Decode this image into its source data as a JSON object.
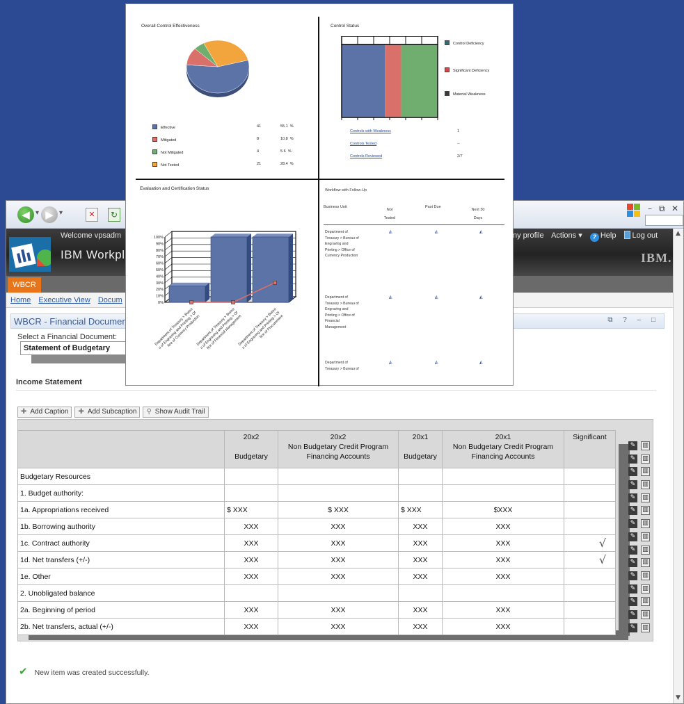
{
  "browser": {
    "app": {
      "welcome": "Welcome vpsadm",
      "title": "IBM Workpla",
      "links": [
        "ny profile",
        "Actions ▾",
        "Help",
        "Log out"
      ],
      "brand": "IBM."
    },
    "tab": "WBCR",
    "nav_links": [
      "Home",
      "Executive View",
      "Docum"
    ],
    "portlet_title": "WBCR - Financial Documen",
    "select_label": "Select a Financial Document:",
    "select_value": "Statement of Budgetary",
    "section_title": "Income Statement",
    "buttons": {
      "add_caption": "Add Caption",
      "add_subcaption": "Add Subcaption",
      "show_audit_trail": "Show Audit Trail"
    },
    "table": {
      "headers": [
        {
          "line1": "",
          "line2": ""
        },
        {
          "line1": "20x2",
          "line2": "",
          "line3": "Budgetary"
        },
        {
          "line1": "20x2",
          "line2": "Non Budgetary Credit Program",
          "line3": "Financing Accounts"
        },
        {
          "line1": "20x1",
          "line2": "",
          "line3": "Budgetary"
        },
        {
          "line1": "20x1",
          "line2": "Non Budgetary Credit Program",
          "line3": "Financing Accounts"
        },
        {
          "line1": "Significant",
          "line2": "",
          "line3": ""
        }
      ],
      "rows": [
        {
          "label": "Budgetary Resources",
          "c1": "",
          "c2": "",
          "c3": "",
          "c4": "",
          "sig": ""
        },
        {
          "label": "1.   Budget authority:",
          "c1": "",
          "c2": "",
          "c3": "",
          "c4": "",
          "sig": ""
        },
        {
          "label": "1a.  Appropriations received",
          "c1": "$     XXX",
          "c2": "$ XXX",
          "c3": "$     XXX",
          "c4": "$XXX",
          "sig": ""
        },
        {
          "label": "1b.  Borrowing authority",
          "c1": "XXX",
          "c2": "XXX",
          "c3": "XXX",
          "c4": "XXX",
          "sig": ""
        },
        {
          "label": "1c.  Contract authority",
          "c1": "XXX",
          "c2": "XXX",
          "c3": "XXX",
          "c4": "XXX",
          "sig": "√"
        },
        {
          "label": "1d.  Net transfers (+/-)",
          "c1": "XXX",
          "c2": "XXX",
          "c3": "XXX",
          "c4": "XXX",
          "sig": "√"
        },
        {
          "label": "1e.  Other",
          "c1": "XXX",
          "c2": "XXX",
          "c3": "XXX",
          "c4": "XXX",
          "sig": ""
        },
        {
          "label": "2.    Unobligated balance",
          "c1": "",
          "c2": "",
          "c3": "",
          "c4": "",
          "sig": ""
        },
        {
          "label": "2a.  Beginning of period",
          "c1": "XXX",
          "c2": "XXX",
          "c3": "XXX",
          "c4": "XXX",
          "sig": ""
        },
        {
          "label": "2b.  Net transfers, actual (+/-)",
          "c1": "XXX",
          "c2": "XXX",
          "c3": "XXX",
          "c4": "XXX",
          "sig": ""
        }
      ]
    },
    "success_message": "New item was created successfully."
  },
  "dashboard": {
    "q1": {
      "title": "Overall Control Effectiveness",
      "legend": [
        {
          "label": "Effective",
          "count": "41",
          "pct": "55.1",
          "unit": "%",
          "color": "#5b73a6"
        },
        {
          "label": "Mitigated",
          "count": "8",
          "pct": "10.8",
          "unit": "%",
          "color": "#d9706a"
        },
        {
          "label": "Not Mitigated",
          "count": "4",
          "pct": "5.6",
          "unit": "%",
          "color": "#6fae6f"
        },
        {
          "label": "Not Tested",
          "count": "21",
          "pct": "28.4",
          "unit": "%",
          "color": "#f2a53c"
        }
      ]
    },
    "q2": {
      "title": "Control Status",
      "legend": [
        {
          "label": "Control Deficiency",
          "color": "#2f6a6f"
        },
        {
          "label": "Significant Deficiency",
          "color": "#c9504a"
        },
        {
          "label": "Material Weakness",
          "color": "#3a3a3a"
        }
      ],
      "links": [
        {
          "label": "Controls with Weakness",
          "value": "1"
        },
        {
          "label": "Controls Tested",
          "value": "--"
        },
        {
          "label": "Controls Reviewed",
          "value": "2/7"
        }
      ]
    },
    "q3": {
      "title": "Evaluation and Certification Status"
    },
    "q4": {
      "title": "Workflow with Follow-Up",
      "headers": [
        "Business Unit",
        "Not Tested",
        "Past Due",
        "Next 30 Days"
      ],
      "rows": [
        "Department of Treasury > Bureau of Engraving and Printing > Office of Currency Production",
        "Department of Treasury > Bureau of Engraving and Printing > Office of Financial Management",
        "Department of Treasury > Bureau of"
      ]
    }
  },
  "chart_data": [
    {
      "type": "pie",
      "title": "Overall Control Effectiveness",
      "categories": [
        "Effective",
        "Mitigated",
        "Not Mitigated",
        "Not Tested"
      ],
      "values": [
        55.1,
        10.8,
        5.6,
        28.4
      ],
      "colors": [
        "#5b73a6",
        "#d9706a",
        "#6fae6f",
        "#f2a53c"
      ]
    },
    {
      "type": "bar",
      "title": "Control Status",
      "stacked_horizontal": true,
      "series": [
        {
          "name": "Control Deficiency",
          "value": 0.45,
          "color": "#5b73a6"
        },
        {
          "name": "Significant Deficiency",
          "value": 0.17,
          "color": "#d9706a"
        },
        {
          "name": "Material Weakness",
          "value": 0.38,
          "color": "#6fae6f"
        }
      ]
    },
    {
      "type": "bar",
      "title": "Evaluation and Certification Status",
      "categories": [
        "Department of Treasury > Bureau of Engraving and Printing > Office of Currency Production",
        "Department of Treasury > Bureau of Engraving and Printing > Office of Financial Management",
        "Department of Treasury > Bureau of Engraving and Printing > Office of Procurement"
      ],
      "values": [
        25,
        100,
        100
      ],
      "line": [
        0,
        0,
        30
      ],
      "yticks": [
        "100%",
        "90%",
        "80%",
        "70%",
        "60%",
        "50%",
        "40%",
        "30%",
        "20%",
        "10%",
        "0%"
      ],
      "ylim": [
        0,
        100
      ]
    }
  ]
}
